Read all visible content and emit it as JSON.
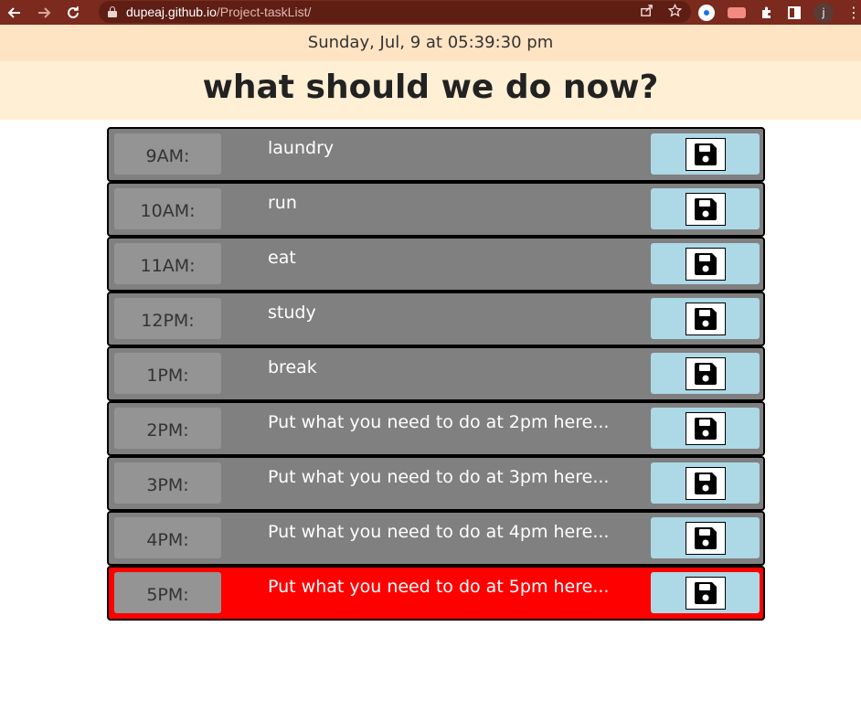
{
  "browser": {
    "url_host": "dupeaj.github.io",
    "url_path": "/Project-taskList/",
    "profile_initial": "j"
  },
  "header": {
    "current_day": "Sunday, Jul, 9 at 05:39:30 pm",
    "title": "what should we do now?"
  },
  "colors": {
    "past": "#808080",
    "present": "#ff0000",
    "save_button": "#add8e6"
  },
  "timeblocks": [
    {
      "hour": "9AM:",
      "text": "laundry",
      "state": "past"
    },
    {
      "hour": "10AM:",
      "text": "run",
      "state": "past"
    },
    {
      "hour": "11AM:",
      "text": "eat",
      "state": "past"
    },
    {
      "hour": "12PM:",
      "text": "study",
      "state": "past"
    },
    {
      "hour": "1PM:",
      "text": "break",
      "state": "past"
    },
    {
      "hour": "2PM:",
      "text": "Put what you need to do at 2pm here...",
      "state": "past"
    },
    {
      "hour": "3PM:",
      "text": "Put what you need to do at 3pm here...",
      "state": "past"
    },
    {
      "hour": "4PM:",
      "text": "Put what you need to do at 4pm here...",
      "state": "past"
    },
    {
      "hour": "5PM:",
      "text": "Put what you need to do at 5pm here...",
      "state": "present"
    }
  ],
  "icons": {
    "save": "floppy-disk-icon"
  }
}
